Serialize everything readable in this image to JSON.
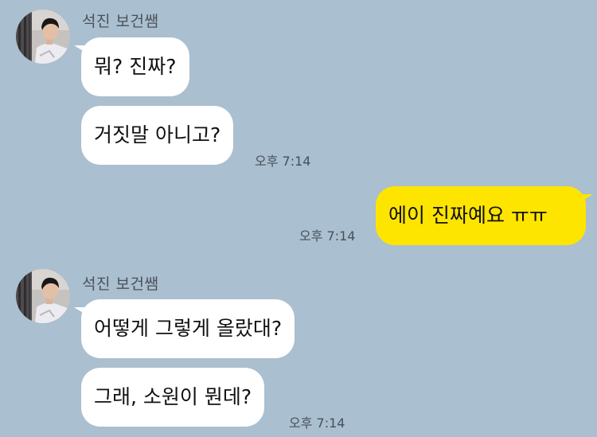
{
  "colors": {
    "background": "#aabfd0",
    "incoming_bubble": "#ffffff",
    "outgoing_bubble": "#fee500",
    "sender_name": "#4a5159",
    "timestamp": "#47505a"
  },
  "groups": [
    {
      "sender": "석진 보건쌤",
      "avatar": "profile-photo",
      "messages": [
        "뭐? 진짜?",
        "거짓말 아니고?"
      ],
      "time": "오후 7:14"
    },
    {
      "sender": "me",
      "messages": [
        "에이 진짜예요 ㅠㅠ"
      ],
      "time": "오후 7:14"
    },
    {
      "sender": "석진 보건쌤",
      "avatar": "profile-photo",
      "messages": [
        "어떻게 그렇게 올랐대?",
        "그래, 소원이 뭔데?"
      ],
      "time": "오후 7:14"
    }
  ]
}
